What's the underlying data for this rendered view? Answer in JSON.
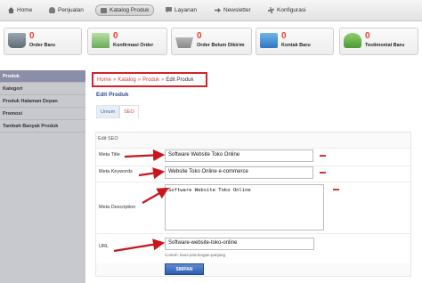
{
  "nav": {
    "items": [
      {
        "label": "Home",
        "icon": "home-icon"
      },
      {
        "label": "Penjualan",
        "icon": "people-icon"
      },
      {
        "label": "Katalog Produk",
        "icon": "catalog-icon"
      },
      {
        "label": "Layanan",
        "icon": "chat-icon"
      },
      {
        "label": "Newsletter",
        "icon": "arrow-icon"
      },
      {
        "label": "Konfigurasi",
        "icon": "gear-icon"
      }
    ],
    "active_index": 2
  },
  "stats": [
    {
      "value": "0",
      "label": "Order Baru",
      "icon": "cart-icon"
    },
    {
      "value": "0",
      "label": "Konfirmasi Order",
      "icon": "list-icon"
    },
    {
      "value": "0",
      "label": "Order Belum Dikirim",
      "icon": "basket-icon"
    },
    {
      "value": "0",
      "label": "Kontak Baru",
      "icon": "mail-icon"
    },
    {
      "value": "0",
      "label": "Testimonial Baru",
      "icon": "users-icon"
    }
  ],
  "sidebar": {
    "items": [
      {
        "label": "Produk"
      },
      {
        "label": "Kategori"
      },
      {
        "label": "Produk Halaman Depan"
      },
      {
        "label": "Promosi"
      },
      {
        "label": "Tambah Banyak Produk"
      }
    ]
  },
  "breadcrumb": {
    "items": [
      "Home",
      "Katalog",
      "Produk",
      "Edit Produk"
    ],
    "separator": "»"
  },
  "page_title": "Edit Produk",
  "tabs": [
    {
      "label": "Umum"
    },
    {
      "label": "SEO"
    }
  ],
  "seo": {
    "legend": "Edit SEO",
    "meta_title_label": "Meta Title",
    "meta_title_value": "Software Website Toko Online",
    "meta_keywords_label": "Meta Keywords",
    "meta_keywords_value": "Website Toko Online e-commerce",
    "meta_description_label": "Meta Description",
    "meta_description_value": "Software Website Toko Online",
    "url_label": "URL",
    "url_value": "Software-website-toko-online",
    "url_hint": "Contoh: kaos-pria-lengan-panjang",
    "save_label": "SIMPAN"
  },
  "colors": {
    "accent_red": "#d2222a",
    "link_blue": "#2b4b8f",
    "sidebar_active": "#8a8ea8",
    "button": "#2f5db0"
  }
}
